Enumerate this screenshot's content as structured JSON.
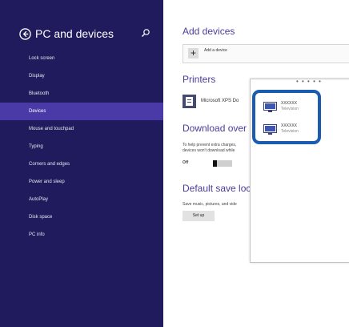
{
  "sidebar": {
    "title": "PC and devices",
    "items": [
      {
        "label": "Lock screen",
        "selected": false
      },
      {
        "label": "Display",
        "selected": false
      },
      {
        "label": "Bluetooth",
        "selected": false
      },
      {
        "label": "Devices",
        "selected": true
      },
      {
        "label": "Mouse and touchpad",
        "selected": false
      },
      {
        "label": "Typing",
        "selected": false
      },
      {
        "label": "Corners and edges",
        "selected": false
      },
      {
        "label": "Power and sleep",
        "selected": false
      },
      {
        "label": "AutoPlay",
        "selected": false
      },
      {
        "label": "Disk space",
        "selected": false
      },
      {
        "label": "PC info",
        "selected": false
      }
    ]
  },
  "main": {
    "add_devices_heading": "Add devices",
    "add_device_label": "Add a device",
    "printers_heading": "Printers",
    "printer_name": "Microsoft XPS Do",
    "download_heading": "Download over",
    "download_text_1": "To help prevent extra charges,",
    "download_text_2": "devices won't download while",
    "toggle_state": "Off",
    "default_save_heading": "Default save loca",
    "default_save_text": "Save music, pictures, and vide",
    "setup_button": "Set up"
  },
  "popup": {
    "dots": "• • • • •",
    "devices": [
      {
        "name": "XXXXXX",
        "type": "Television"
      },
      {
        "name": "XXXXXX",
        "type": "Television"
      }
    ]
  },
  "colors": {
    "sidebar_bg": "#1f1b5c",
    "selected_bg": "#4a3aa8",
    "heading": "#4a3c9c",
    "highlight": "#1a5cb0"
  }
}
